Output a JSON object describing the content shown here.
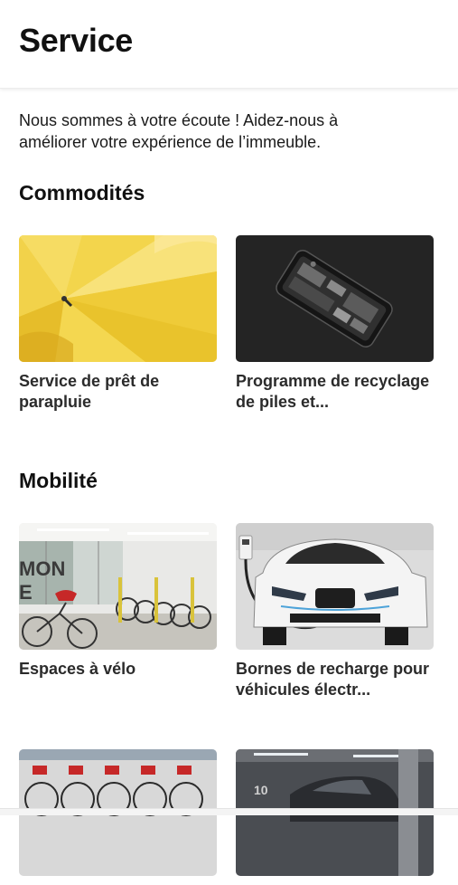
{
  "header": {
    "title": "Service"
  },
  "intro": {
    "text": "Nous sommes à votre écoute ! Aidez-nous à améliorer votre expérience de l’immeuble."
  },
  "sections": [
    {
      "title": "Commodités",
      "cards": [
        {
          "label": "Service de prêt de parapluie",
          "image": "yellow-umbrellas"
        },
        {
          "label": "Programme de recyclage de piles et...",
          "image": "phone-battery"
        }
      ]
    },
    {
      "title": "Mobilité",
      "cards": [
        {
          "label": "Espaces à vélo",
          "image": "bike-room"
        },
        {
          "label": "Bornes de recharge pour véhicules électr...",
          "image": "ev-charging"
        },
        {
          "label": "",
          "image": "bike-rack"
        },
        {
          "label": "",
          "image": "parking-garage"
        }
      ]
    }
  ],
  "colors": {
    "background": "#ffffff",
    "text": "#111111",
    "umbrella_yellow": "#f3d34a"
  }
}
